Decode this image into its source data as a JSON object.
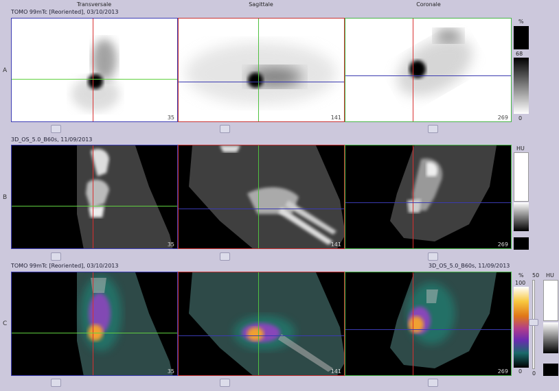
{
  "headers": {
    "transversale": "Transversale",
    "sagittale": "Sagittale",
    "coronale": "Coronale"
  },
  "rows": {
    "a": "A",
    "b": "B",
    "c": "C"
  },
  "titles": {
    "spect": "TOMO 99mTc [Reoriented], 03/10/2013",
    "ct": "3D_OS_5.0_B60s, 11/09/2013",
    "fusion_left": "TOMO 99mTc [Reoriented], 03/10/2013",
    "fusion_right": "3D_OS_5.0_B60s, 11/09/2013"
  },
  "slices": {
    "trans": "35",
    "sag": "141",
    "cor": "269"
  },
  "scales": {
    "a_unit": "%",
    "a_mid": "68",
    "a_min": "0",
    "b_unit": "HU",
    "c_unit": "%",
    "c_max": "100",
    "c_min": "0",
    "c_right_top": "50",
    "c_right_bottom": "0",
    "c_hu": "HU"
  },
  "colors": {
    "transversal_border": "#3c3cb4",
    "sagittal_border": "#c83232",
    "coronal_border": "#46b446",
    "bg": "#ccc8dc"
  }
}
